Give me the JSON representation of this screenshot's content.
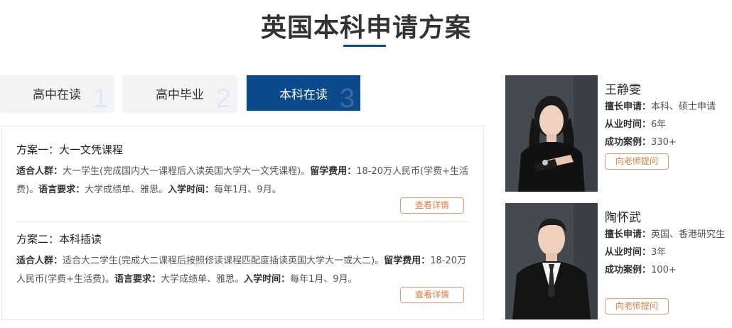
{
  "page": {
    "title": "英国本科申请方案"
  },
  "tabs": [
    {
      "label": "高中在读",
      "num": "1",
      "active": false
    },
    {
      "label": "高中毕业",
      "num": "2",
      "active": false
    },
    {
      "label": "本科在读",
      "num": "3",
      "active": true
    }
  ],
  "plans": [
    {
      "title": "方案一：大一文凭课程",
      "audience_label": "适合人群",
      "audience": "大一学生(完成国内大一课程后入读英国大学大一文凭课程)。",
      "fee_label": "留学费用",
      "fee": "18-20万人民币(学费+生活费)。",
      "lang_label": "语言要求",
      "lang": "大学成绩单、雅思。",
      "intake_label": "入学时间",
      "intake": "每年1月、9月。",
      "button": "查看详情"
    },
    {
      "title": "方案二：本科插读",
      "audience_label": "适合人群",
      "audience": "适合大二学生(完成大二课程后按照修读课程匹配度插读英国大学大一或大二)。",
      "fee_label": "留学费用",
      "fee": "18-20万人民币(学费+生活费)。",
      "lang_label": "语言要求",
      "lang": "大学成绩单、雅思。",
      "intake_label": "入学时间",
      "intake": "每年1月、9月。",
      "button": "查看详情"
    }
  ],
  "teachers": [
    {
      "name": "王静雯",
      "specialty_label": "擅长申请",
      "specialty": "本科、硕士申请",
      "years_label": "从业时间",
      "years": "6年",
      "cases_label": "成功案例",
      "cases": "330+",
      "button": "向老师提问"
    },
    {
      "name": "陶怀武",
      "specialty_label": "擅长申请",
      "specialty": "英国、香港研究生",
      "years_label": "从业时间",
      "years": "3年",
      "cases_label": "成功案例",
      "cases": "100+",
      "button": "向老师提问"
    }
  ],
  "colors": {
    "accent": "#0b4a8b",
    "button_orange": "#e07b41"
  }
}
